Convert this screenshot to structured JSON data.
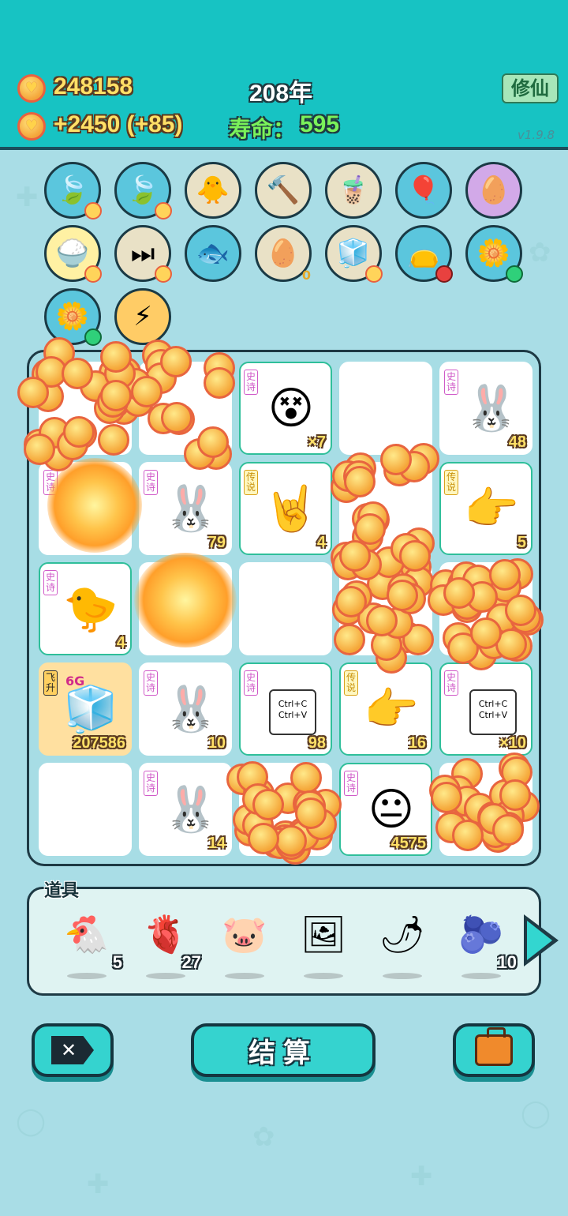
{
  "header": {
    "coins": "248158",
    "income": "+2450 (+85)",
    "year": "208年",
    "life_label": "寿命：",
    "life_value": "595",
    "xiuxian_button": "修仙",
    "version": "v1.9.8"
  },
  "items": [
    {
      "icon": "leaf-icon",
      "glyph": "🍃"
    },
    {
      "icon": "leaf-icon",
      "glyph": "🍃"
    },
    {
      "icon": "chick-icon",
      "glyph": "🐥"
    },
    {
      "icon": "hammer-icon",
      "glyph": "🔨"
    },
    {
      "icon": "bubble-tea-icon",
      "glyph": "🧋"
    },
    {
      "icon": "pump-icon",
      "glyph": "🎈"
    },
    {
      "icon": "egg-icon",
      "glyph": "🥚"
    },
    {
      "icon": "rice-bowl-icon",
      "glyph": "🍚"
    },
    {
      "icon": "skip-icon",
      "glyph": "⏭"
    },
    {
      "icon": "fish-bowl-icon",
      "glyph": "🐟"
    },
    {
      "icon": "egg-tray-icon",
      "glyph": "🥚",
      "count": "0"
    },
    {
      "icon": "sugar-cubes-icon",
      "glyph": "🧊"
    },
    {
      "icon": "sack-icon",
      "glyph": "👝"
    },
    {
      "icon": "flower-pot-icon",
      "glyph": "🌼"
    },
    {
      "icon": "flower-pot-icon",
      "glyph": "🌼"
    },
    {
      "icon": "lightning-icon",
      "glyph": "⚡"
    }
  ],
  "board": {
    "cells": [
      {
        "tag": "",
        "count": "",
        "glyph": ""
      },
      {
        "tag": "",
        "count": "",
        "glyph": ""
      },
      {
        "tag": "史诗",
        "count": "×7",
        "glyph": "😵"
      },
      {
        "tag": "",
        "count": "",
        "glyph": ""
      },
      {
        "tag": "史诗",
        "count": "48",
        "glyph": "🐰"
      },
      {
        "tag": "史诗",
        "count": "",
        "glyph": ""
      },
      {
        "tag": "史诗",
        "count": "79",
        "glyph": "🐰"
      },
      {
        "tag": "传说",
        "count": "4",
        "glyph": "🤘"
      },
      {
        "tag": "",
        "count": "",
        "glyph": ""
      },
      {
        "tag": "传说",
        "count": "5",
        "glyph": "👉"
      },
      {
        "tag": "史诗",
        "count": "4",
        "glyph": "🐤"
      },
      {
        "tag": "",
        "count": "",
        "glyph": ""
      },
      {
        "tag": "",
        "count": "",
        "glyph": ""
      },
      {
        "tag": "",
        "count": "",
        "glyph": ""
      },
      {
        "tag": "",
        "count": "",
        "glyph": ""
      },
      {
        "tag": "飞升",
        "count": "207586",
        "glyph": "🧊",
        "extra": "6G"
      },
      {
        "tag": "史诗",
        "count": "10",
        "glyph": "🐰"
      },
      {
        "tag": "史诗",
        "count": "98",
        "glyph": "Ctrl+C Ctrl+V"
      },
      {
        "tag": "传说",
        "count": "16",
        "glyph": "👉"
      },
      {
        "tag": "史诗",
        "count": "×10",
        "glyph": "Ctrl+C Ctrl+V"
      },
      {
        "tag": "",
        "count": "",
        "glyph": ""
      },
      {
        "tag": "史诗",
        "count": "14",
        "glyph": "🐰"
      },
      {
        "tag": "",
        "count": "",
        "glyph": ""
      },
      {
        "tag": "史诗",
        "count": "4575",
        "glyph": "😐"
      },
      {
        "tag": "",
        "count": "",
        "glyph": ""
      }
    ]
  },
  "tools": {
    "label": "道具",
    "items": [
      {
        "icon": "chicken-icon",
        "glyph": "🐔",
        "count": "5"
      },
      {
        "icon": "liver-icon",
        "glyph": "🫀",
        "count": "27"
      },
      {
        "icon": "piggy-bank-icon",
        "glyph": "🐷",
        "count": ""
      },
      {
        "icon": "frame-icon",
        "glyph": "🖼",
        "count": ""
      },
      {
        "icon": "chili-icon",
        "glyph": "🌶",
        "count": ""
      },
      {
        "icon": "blueberry-icon",
        "glyph": "🫐",
        "count": "10"
      }
    ]
  },
  "buttons": {
    "close": "✕",
    "settle": "结算",
    "bag": ""
  },
  "colors": {
    "header": "#17c3c3",
    "background": "#a9dde6",
    "coin": "#f5a638",
    "button": "#35d3cf"
  }
}
